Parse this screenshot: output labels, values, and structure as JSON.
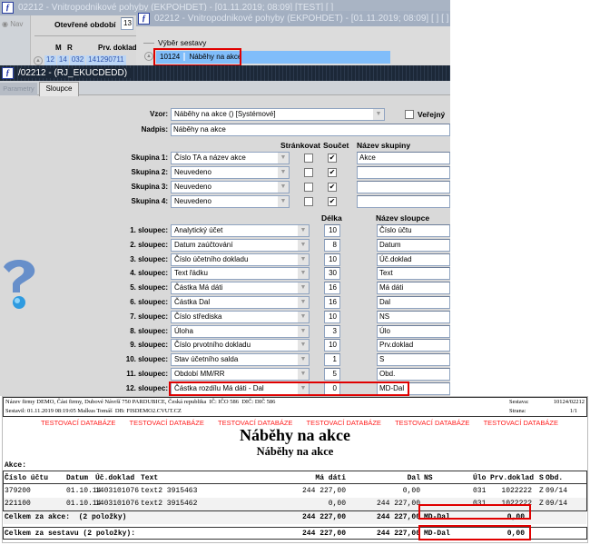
{
  "window1": {
    "title": "02212 - Vnitropodnikové pohyby (EKPOHDET) - [01.11.2019; 08:09]  [TEST]  [ ]",
    "nav_label": "Nav",
    "period_label": "Otevřené období",
    "period_value": "13",
    "cols": [
      "M",
      "R",
      "Prv. doklad"
    ],
    "row": [
      "12",
      "14",
      "032",
      "141290711"
    ]
  },
  "window2": {
    "title": "02212 - Vnitropodnikové pohyby (EKPOHDET) - [01.11.2019; 08:09]  [ ]  [ ]",
    "group_label": "Výběr sestavy",
    "selected_id": "10124",
    "selected_name": "Náběhy na akce"
  },
  "window3": {
    "title": "/02212 - (RJ_EKUCDEDD)",
    "tabs": [
      {
        "label": "Parametry"
      },
      {
        "label": "Sloupce"
      }
    ]
  },
  "form": {
    "vzor_label": "Vzor:",
    "vzor_value": "Náběhy na akce   ()   [Systémové]",
    "public_label": "Veřejný",
    "nadpis_label": "Nadpis:",
    "nadpis_value": "Náběhy na akce",
    "hdr_paging": "Stránkovat",
    "hdr_sum": "Součet",
    "hdr_group_name": "Název skupiny",
    "groups": [
      {
        "label": "Skupina 1:",
        "value": "Číslo TA a název akce",
        "paging": false,
        "sum": true,
        "name": "Akce"
      },
      {
        "label": "Skupina 2:",
        "value": "Neuvedeno",
        "paging": false,
        "sum": true,
        "name": ""
      },
      {
        "label": "Skupina 3:",
        "value": "Neuvedeno",
        "paging": false,
        "sum": true,
        "name": ""
      },
      {
        "label": "Skupina 4:",
        "value": "Neuvedeno",
        "paging": false,
        "sum": true,
        "name": ""
      }
    ],
    "hdr_length": "Délka",
    "hdr_col_name": "Název sloupce",
    "columns": [
      {
        "label": "1. sloupec:",
        "value": "Analytický účet",
        "length": "10",
        "name": "Číslo účtu"
      },
      {
        "label": "2. sloupec:",
        "value": "Datum zaúčtování",
        "length": "8",
        "name": "Datum"
      },
      {
        "label": "3. sloupec:",
        "value": "Číslo účetního dokladu",
        "length": "10",
        "name": "Úč.doklad"
      },
      {
        "label": "4. sloupec:",
        "value": "Text řádku",
        "length": "30",
        "name": "Text"
      },
      {
        "label": "5. sloupec:",
        "value": "Částka Má dáti",
        "length": "16",
        "name": "Má dáti"
      },
      {
        "label": "6. sloupec:",
        "value": "Částka Dal",
        "length": "16",
        "name": "Dal"
      },
      {
        "label": "7. sloupec:",
        "value": "Číslo střediska",
        "length": "10",
        "name": "NS"
      },
      {
        "label": "8. sloupec:",
        "value": "Úloha",
        "length": "3",
        "name": "Úlo"
      },
      {
        "label": "9. sloupec:",
        "value": "Číslo prvotního dokladu",
        "length": "10",
        "name": "Prv.doklad"
      },
      {
        "label": "10. sloupec:",
        "value": "Stav účetního salda",
        "length": "1",
        "name": "S"
      },
      {
        "label": "11. sloupec:",
        "value": "Období MM/RR",
        "length": "5",
        "name": "Obd."
      },
      {
        "label": "12. sloupec:",
        "value": "Částka rozdílu Má dáti - Dal",
        "length": "0",
        "name": "MD-Dal"
      }
    ]
  },
  "report": {
    "company_line": "Název firmy DEMO, Část firmy, Dubové Návrší 750 PARDUBICE, Česká republika  IČ: IČO 586  DIČ: DIČ 586",
    "author_line": "Sestavil: 01.11.2019 08:19:05 Malkus Tomáš  DB: FISDEMO2.CVUT.CZ",
    "sestava_label": "Sestava:",
    "sestava_value": "10124/02212",
    "strana_label": "Strana:",
    "strana_value": "1/1",
    "watermark": [
      "TESTOVACÍ DATABÁZE",
      "TESTOVACÍ DATABÁZE",
      "TESTOVACÍ DATABÁZE",
      "TESTOVACÍ DATABÁZE",
      "TESTOVACÍ DATABÁZE",
      "TESTOVACÍ DATABÁZE"
    ],
    "title": "Náběhy na akce",
    "subtitle": "Náběhy na akce",
    "group_header": "Akce:",
    "headers": [
      "Číslo účtu",
      "Datum",
      "Úč.doklad",
      "Text",
      "Má dáti",
      "Dal",
      "NS",
      "Úlo",
      "Prv.doklad",
      "S",
      "Obd."
    ],
    "rows": [
      [
        "379200",
        "01.10.14",
        "1403101076",
        "text2 3915463",
        "244 227,00",
        "0,00",
        "",
        "031",
        "1022222",
        "Z",
        "09/14"
      ],
      [
        "221100",
        "01.10.14",
        "1403101076",
        "text2 3915462",
        "0,00",
        "244 227,00",
        "",
        "031",
        "1022222",
        "Z",
        "09/14"
      ]
    ],
    "group_total": {
      "label": "Celkem za akce:  (2 položky)",
      "md": "244 227,00",
      "dal": "244 227,00",
      "diff_label": "MD-Dal",
      "diff": "0,00"
    },
    "grand_total": {
      "label": "Celkem za sestavu (2 položky):",
      "md": "244 227,00",
      "dal": "244 227,00",
      "diff_label": "MD-Dal",
      "diff": "0,00"
    }
  }
}
